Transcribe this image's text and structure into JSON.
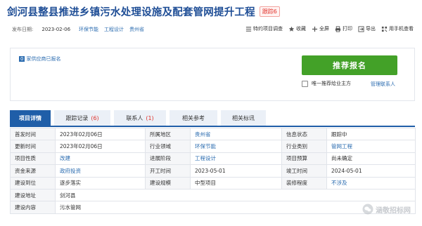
{
  "header": {
    "title": "剑河县整县推进乡镇污水处理设施及配套管网提升工程",
    "badge": "跟踪6"
  },
  "meta": {
    "date_label": "发布日期:",
    "date": "2023-02-06",
    "tags": [
      "环保节能",
      "工程设计",
      "贵州省"
    ]
  },
  "tools": [
    "特约项目调查",
    "收藏",
    "全屏",
    "打印",
    "导出",
    "用手机查看"
  ],
  "card": {
    "supplier_count": "0",
    "supplier_text": "家供应商已报名",
    "register_button": "推荐报名",
    "checkbox_label": "唯一推荐给业主方",
    "contact_link": "管理联系人"
  },
  "tabs": [
    {
      "label": "项目详情",
      "count": "",
      "width": 58
    },
    {
      "label": "跟踪记录",
      "count": "(6)",
      "width": 80
    },
    {
      "label": "联系人",
      "count": "(1)",
      "width": 74
    },
    {
      "label": "相关参考",
      "count": "",
      "width": 68
    },
    {
      "label": "相关标讯",
      "count": "",
      "width": 64
    }
  ],
  "details": [
    [
      [
        "首发时间",
        "2023年02月06日",
        "v"
      ],
      [
        "所属地区",
        "贵州省",
        "link"
      ],
      [
        "信息状态",
        "跟踪中",
        "v"
      ]
    ],
    [
      [
        "更新时间",
        "2023年02月06日",
        "v"
      ],
      [
        "行业领域",
        "环保节能",
        "link"
      ],
      [
        "行业类别",
        "管网工程",
        "link"
      ]
    ],
    [
      [
        "项目性质",
        "改建",
        "link"
      ],
      [
        "进展阶段",
        "工程设计",
        "link"
      ],
      [
        "项目预算",
        "尚未确定",
        "v"
      ]
    ],
    [
      [
        "资金来源",
        "政府投资",
        "link"
      ],
      [
        "开工时间",
        "2023-05-01",
        "v"
      ],
      [
        "竣工时间",
        "2024-05-01",
        "v"
      ]
    ],
    [
      [
        "建设到位",
        "逐步落实",
        "v"
      ],
      [
        "建设规模",
        "中型项目",
        "v"
      ],
      [
        "装修程度",
        "不涉及",
        "link"
      ]
    ],
    [
      [
        "建设地址",
        "剑河县",
        "v"
      ]
    ],
    [
      [
        "建设内容",
        "污水管网",
        "v"
      ]
    ]
  ],
  "watermark": "涵敬招标网"
}
